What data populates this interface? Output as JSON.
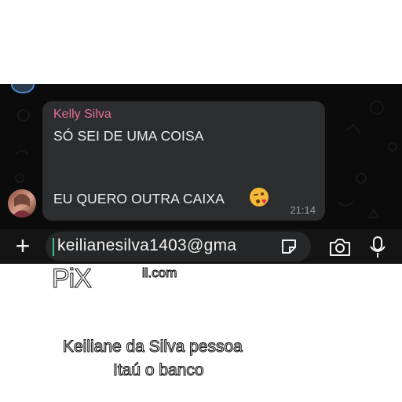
{
  "message": {
    "sender": "Kelly Silva",
    "line1": "SÓ SEI DE UMA COISA",
    "line2": "EU QUERO OUTRA CAIXA",
    "emoji": "face-blowing-kiss",
    "time": "21:14"
  },
  "composer": {
    "text": "keilianesilva1403@gma"
  },
  "overlay": {
    "pix": "PiX",
    "email_cont": "il.com",
    "caption_line1": "Keiliane da Silva pessoa",
    "caption_line2": "Itaú o banco"
  },
  "colors": {
    "chat_bg": "#0b0b0b",
    "bubble_bg": "#2b2d2f",
    "sender_color": "#e46f95",
    "cursor_color": "#3cbf8a"
  }
}
